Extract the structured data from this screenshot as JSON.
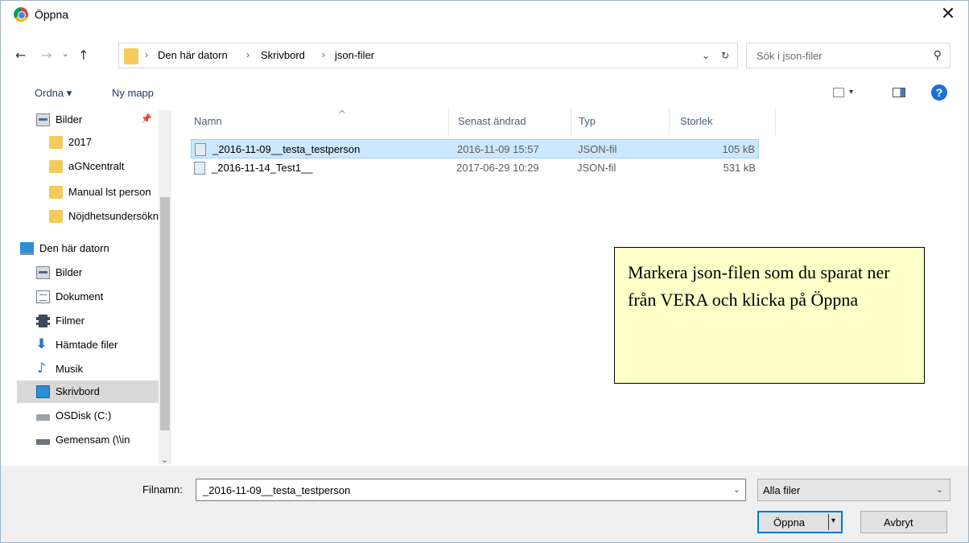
{
  "window": {
    "title": "Öppna",
    "close_glyph": "✕"
  },
  "nav": {
    "back": "←",
    "forward": "→",
    "dropdown": "⌄",
    "up": "↑"
  },
  "address": {
    "crumbs": [
      "Den här datorn",
      "Skrivbord",
      "json-filer"
    ],
    "separator": "›",
    "dropdown": "⌄",
    "refresh": "↻"
  },
  "search": {
    "placeholder": "Sök i json-filer",
    "icon": "⚲"
  },
  "toolbar": {
    "ordna_label": "Ordna ▾",
    "nymapp_label": "Ny mapp",
    "help_label": "?",
    "view_dropdown": "▾"
  },
  "sidebar": {
    "pin_glyph": "📌",
    "scroll_up": "^",
    "scroll_down": "⌄",
    "items": [
      {
        "label": "Bilder",
        "icon": "pictures-icon"
      },
      {
        "label": "2017",
        "icon": "folder-icon"
      },
      {
        "label": "aGNcentralt",
        "icon": "folder-icon"
      },
      {
        "label": "Manual lst person",
        "icon": "folder-icon"
      },
      {
        "label": "Nöjdhetsundersökning",
        "icon": "folder-icon"
      },
      {
        "label": "Den här datorn",
        "icon": "computer-icon"
      },
      {
        "label": "Bilder",
        "icon": "pictures-icon"
      },
      {
        "label": "Dokument",
        "icon": "documents-icon"
      },
      {
        "label": "Filmer",
        "icon": "videos-icon"
      },
      {
        "label": "Hämtade filer",
        "icon": "downloads-icon",
        "glyph": "⬇"
      },
      {
        "label": "Musik",
        "icon": "music-icon",
        "glyph": "♪"
      },
      {
        "label": "Skrivbord",
        "icon": "desktop-icon",
        "selected": true
      },
      {
        "label": "OSDisk (C:)",
        "icon": "disk-icon"
      },
      {
        "label": "Gemensam (\\\\in",
        "icon": "network-drive-icon"
      }
    ]
  },
  "filelist": {
    "columns": {
      "name": "Namn",
      "modified": "Senast ändrad",
      "type": "Typ",
      "size": "Storlek"
    },
    "sort_glyph": "^",
    "rows": [
      {
        "name": "_2016-11-09__testa_testperson",
        "modified": "2016-11-09 15:57",
        "type": "JSON-fil",
        "size": "105 kB",
        "selected": true
      },
      {
        "name": "_2016-11-14_Test1__",
        "modified": "2017-06-29 10:29",
        "type": "JSON-fil",
        "size": "531 kB",
        "selected": false
      }
    ]
  },
  "callout": {
    "text": "Markera json-filen som du sparat ner från VERA och klicka på Öppna"
  },
  "bottom": {
    "filename_label": "Filnamn:",
    "filename_value": "_2016-11-09__testa_testperson",
    "filename_dropdown": "⌄",
    "filter_value": "Alla filer",
    "filter_dropdown": "⌄",
    "open_label": "Öppna",
    "open_dropdown": "▾",
    "cancel_label": "Avbryt"
  },
  "colors": {
    "accent": "#0078d7",
    "selection": "#cce8ff",
    "callout_bg": "#ffffc8",
    "folder": "#f4cc5a"
  }
}
